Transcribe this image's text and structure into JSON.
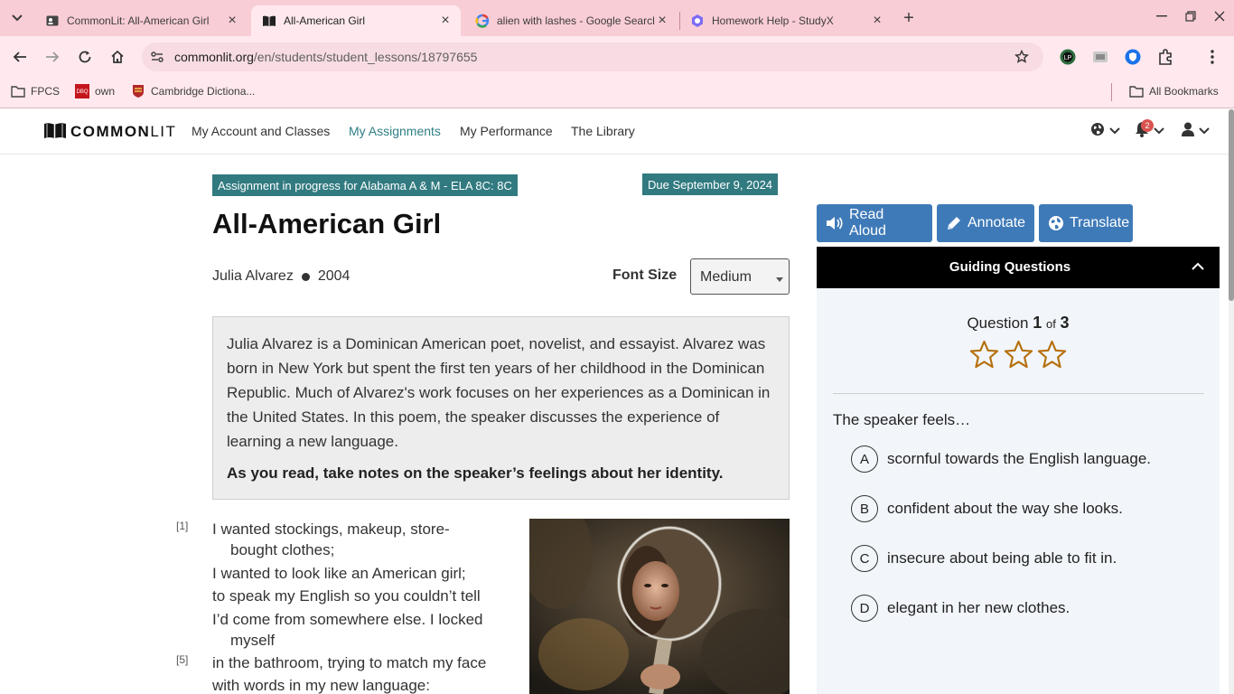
{
  "browser": {
    "tabs": [
      {
        "title": "CommonLit: All-American Girl",
        "icon": "student-card-icon",
        "active": false
      },
      {
        "title": "All-American Girl",
        "icon": "open-book-icon",
        "active": true
      },
      {
        "title": "alien with lashes - Google Search",
        "icon": "google-g-icon",
        "active": false
      },
      {
        "title": "Homework Help - StudyX",
        "icon": "studyx-icon",
        "active": false
      }
    ],
    "url_host": "commonlit.org",
    "url_path": "/en/students/student_lessons/18797655",
    "bookmarks": [
      {
        "label": "FPCS",
        "icon": "folder-icon"
      },
      {
        "label": "own",
        "icon": "dbq-online-icon"
      },
      {
        "label": "Cambridge Dictiona...",
        "icon": "cambridge-shield-icon"
      }
    ],
    "all_bookmarks": "All Bookmarks",
    "colors": {
      "frame": "#f9cdd6",
      "toolbar": "#ffe9ee"
    }
  },
  "site": {
    "logo_bold": "COMMON",
    "logo_light": "LIT",
    "nav": [
      "My Account and Classes",
      "My Assignments",
      "My Performance",
      "The Library"
    ],
    "active_nav": "My Assignments",
    "notification_count": "2"
  },
  "lesson": {
    "assignment_status": "Assignment in progress for Alabama A & M - ELA 8C: 8C",
    "due": "Due September 9, 2024",
    "title": "All-American Girl",
    "author": "Julia Alvarez",
    "year": "2004",
    "font_size_label": "Font Size",
    "font_size_value": "Medium",
    "intro": "Julia Alvarez is a Dominican American poet, novelist, and essayist. Alvarez was born in New York but spent the first ten years of her childhood in the Dominican Republic. Much of Alvarez's work focuses on her experiences as a Dominican in the United States. In this poem, the speaker discusses the experience of learning a new language.",
    "instruction": "As you read, take notes on the speaker’s feelings about her identity.",
    "poem_lines": [
      {
        "num": "[1]",
        "text": "I wanted stockings, makeup, store-",
        "cont": false
      },
      {
        "num": "",
        "text": "bought clothes;",
        "cont": true
      },
      {
        "num": "",
        "text": "I wanted to look like an American girl;",
        "cont": false
      },
      {
        "num": "",
        "text": "to speak my English so you couldn’t tell",
        "cont": false
      },
      {
        "num": "",
        "text": "I’d come from somewhere else. I locked",
        "cont": false
      },
      {
        "num": "",
        "text": "myself",
        "cont": true
      },
      {
        "num": "[5]",
        "text": "in the bathroom, trying to match my face",
        "cont": false
      },
      {
        "num": "",
        "text": "with words in my new language:",
        "cont": false
      }
    ]
  },
  "panel": {
    "tools": [
      {
        "label": "Read Aloud",
        "icon": "speaker-icon"
      },
      {
        "label": "Annotate",
        "icon": "pencil-icon"
      },
      {
        "label": "Translate",
        "icon": "globe-icon"
      }
    ],
    "tool_color": "#3f7ab8",
    "guiding_title": "Guiding Questions",
    "question_word": "Question",
    "question_current": "1",
    "question_of": "of",
    "question_total": "3",
    "stars_filled": 0,
    "stars_total": 3,
    "prompt": "The speaker feels…",
    "choices": [
      {
        "letter": "A",
        "text": "scornful towards the English language."
      },
      {
        "letter": "B",
        "text": "confident about the way she looks."
      },
      {
        "letter": "C",
        "text": "insecure about being able to fit in."
      },
      {
        "letter": "D",
        "text": "elegant in her new clothes."
      }
    ]
  }
}
